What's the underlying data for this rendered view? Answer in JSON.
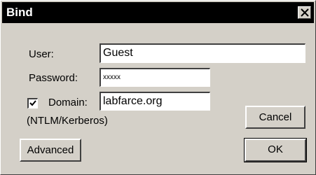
{
  "window": {
    "title": "Bind",
    "close_icon": "close-icon"
  },
  "form": {
    "user_label": "User:",
    "user_value": "Guest",
    "password_label": "Password:",
    "password_value": "xxxxx",
    "domain_label": "Domain:",
    "domain_checked": true,
    "domain_value": "labfarce.org",
    "domain_note": "(NTLM/Kerberos)"
  },
  "buttons": {
    "cancel": "Cancel",
    "advanced": "Advanced",
    "ok": "OK"
  }
}
